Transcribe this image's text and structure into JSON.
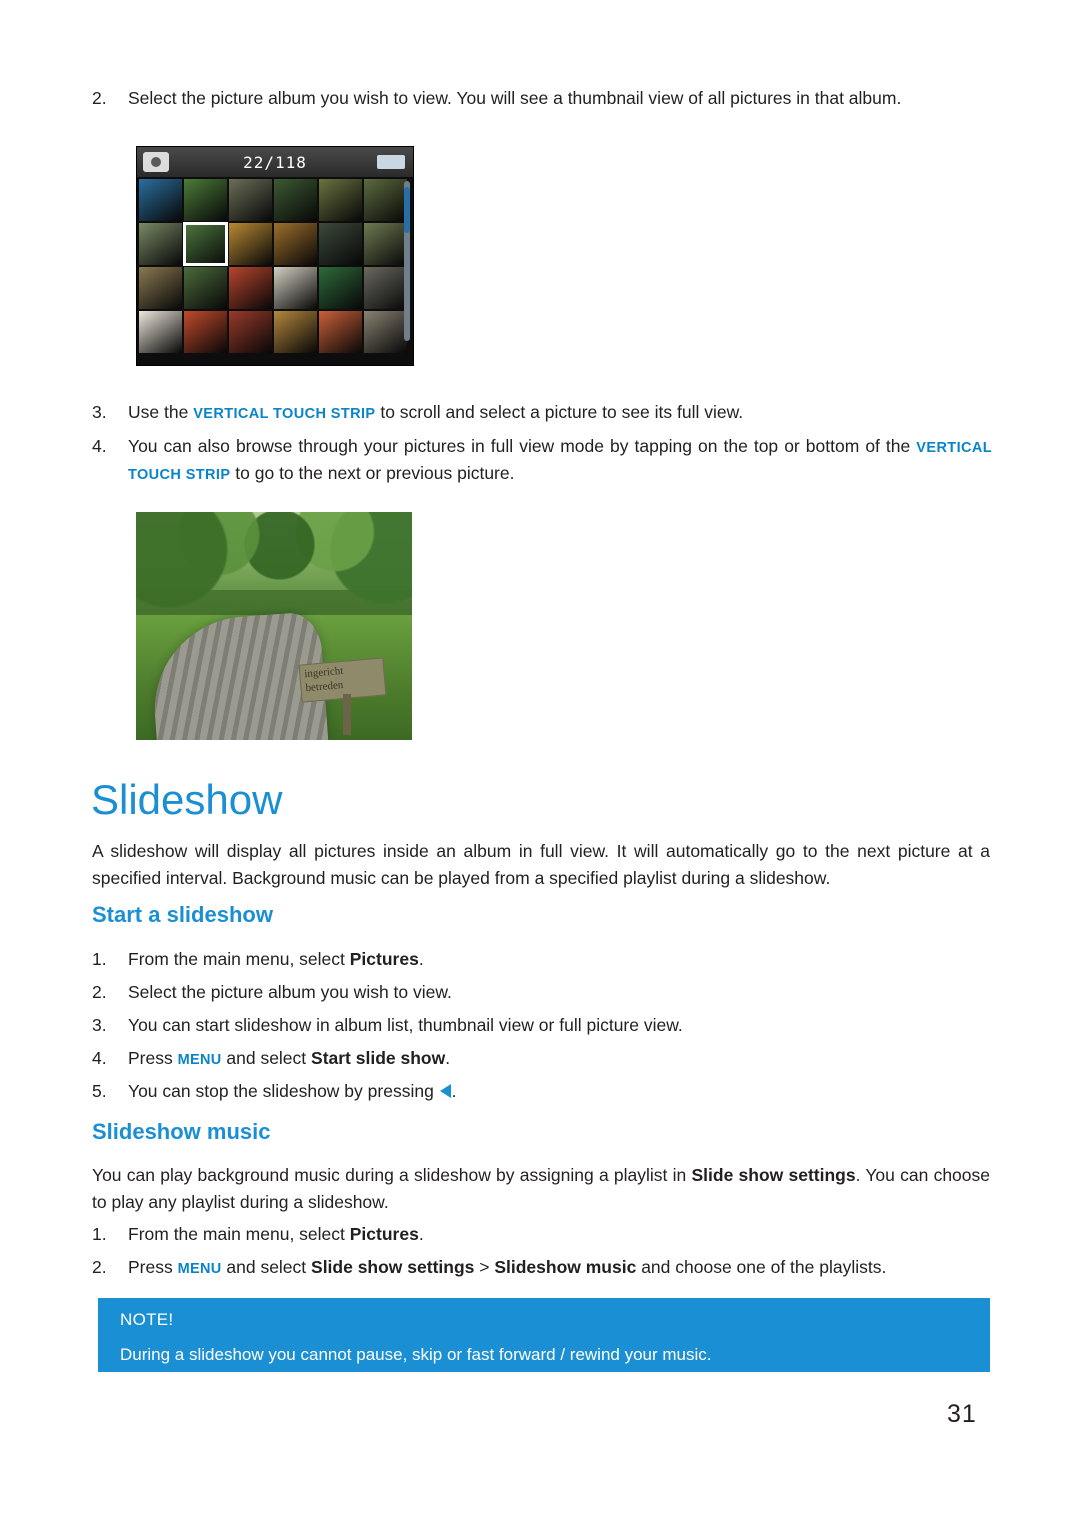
{
  "document": {
    "page_number": "31"
  },
  "steps_top": [
    {
      "num": "2.",
      "text": "Select the picture album you wish to view. You will see a thumbnail view of all pictures in that album."
    },
    {
      "num": "3.",
      "prefix": "Use the ",
      "caps": "VERTICAL TOUCH STRIP",
      "suffix": " to scroll and select a picture to see its full view."
    },
    {
      "num": "4.",
      "prefix": "You can also browse through your pictures in full view mode by tapping on the top or bottom of the ",
      "caps": "VERTICAL TOUCH STRIP",
      "suffix": " to go to the next or previous picture."
    }
  ],
  "device_screen": {
    "title": "22/118",
    "camera_icon": "camera-icon",
    "battery_icon": "battery-icon",
    "selected_index": 7,
    "thumb_colors": [
      "#2b6f9e",
      "#4c7c3a",
      "#6b6f58",
      "#3d5a33",
      "#6a7240",
      "#5c6b3f",
      "#7a8a66",
      "#4f7a40",
      "#b98a33",
      "#9d6f2c",
      "#3c4a3a",
      "#6e7a52",
      "#8a7a52",
      "#4c6b3c",
      "#b8452e",
      "#d5d0c2",
      "#2f6a3a",
      "#6a6a60",
      "#efe8dc",
      "#c24a2c",
      "#9a3a2a",
      "#b4873d",
      "#c9603a",
      "#8a8272"
    ]
  },
  "photo": {
    "alt_name": "boardwalk-forest-photo",
    "sign_line1": "ingericht",
    "sign_line2": "betreden"
  },
  "slideshow": {
    "heading": "Slideshow",
    "intro": "A slideshow will display all pictures inside an album in full view. It will automatically go to the next picture at a specified interval. Background music can be played from a specified playlist during a slideshow.",
    "start_heading": "Start a slideshow",
    "start_steps": [
      {
        "num": "1.",
        "plain_pre": "From the main menu, select ",
        "bold": "Pictures",
        "plain_post": "."
      },
      {
        "num": "2.",
        "plain_pre": "Select the picture album you wish to view.",
        "bold": "",
        "plain_post": ""
      },
      {
        "num": "3.",
        "plain_pre": "You can start slideshow in album list, thumbnail view or full picture view.",
        "bold": "",
        "plain_post": ""
      },
      {
        "num": "4.",
        "plain_pre": "Press ",
        "caps": "MENU",
        "mid": " and select ",
        "bold": "Start slide show",
        "plain_post": "."
      },
      {
        "num": "5.",
        "plain_pre": "You can stop the slideshow by pressing ",
        "bold": "",
        "plain_post": "."
      }
    ],
    "music_heading": "Slideshow music",
    "music_intro_pre": "You can play background music during a slideshow by assigning a playlist in ",
    "music_intro_bold": "Slide show settings",
    "music_intro_post": ". You can choose to play any playlist during a slideshow.",
    "music_steps": [
      {
        "num": "1.",
        "plain_pre": "From the main menu, select ",
        "bold": "Pictures",
        "plain_post": "."
      },
      {
        "num": "2.",
        "plain_pre": "Press ",
        "caps": "MENU",
        "mid": " and select ",
        "bold": "Slide show settings",
        "mid2": " > ",
        "bold2": "Slideshow music",
        "plain_post": " and choose one of the playlists."
      }
    ]
  },
  "note": {
    "title": "NOTE!",
    "text": "During a slideshow you cannot pause, skip or fast forward / rewind your music.",
    "color": "#1b8fd4"
  }
}
